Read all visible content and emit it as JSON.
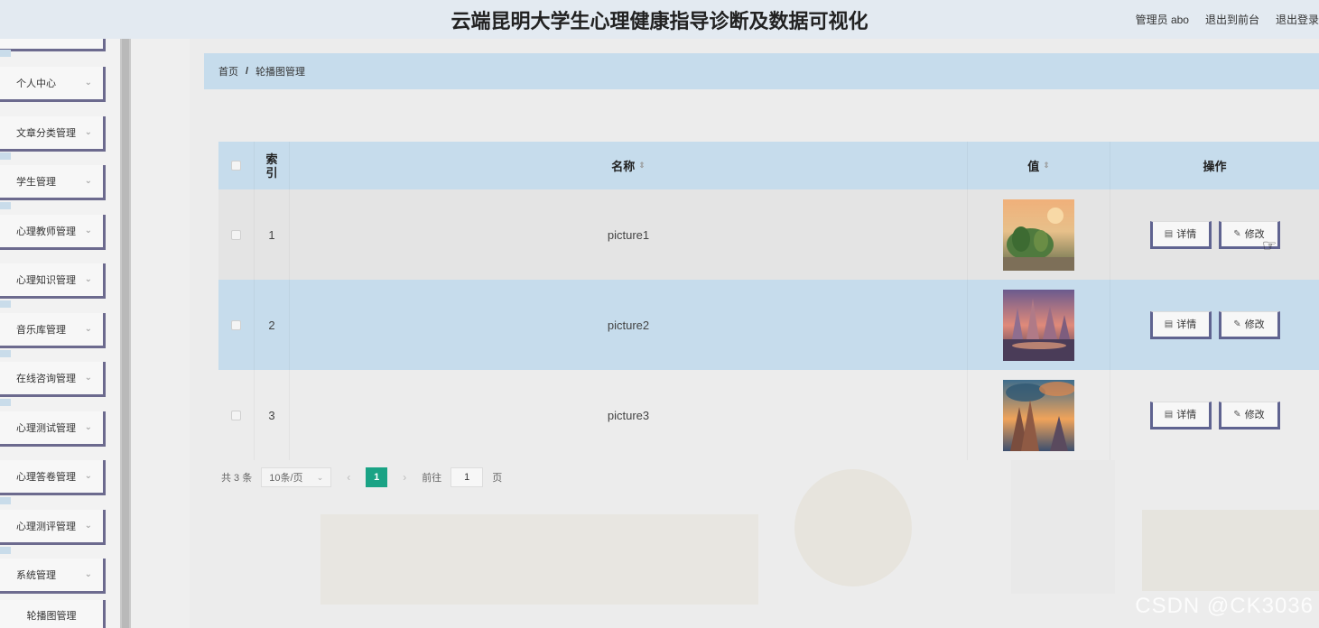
{
  "header": {
    "title": "云端昆明大学生心理健康指导诊断及数据可视化",
    "user_label": "管理员 abo",
    "to_front_label": "退出到前台",
    "logout_label": "退出登录"
  },
  "sidebar": {
    "items": [
      {
        "label": "个人中心"
      },
      {
        "label": "文章分类管理"
      },
      {
        "label": "学生管理"
      },
      {
        "label": "心理教师管理"
      },
      {
        "label": "心理知识管理"
      },
      {
        "label": "音乐库管理"
      },
      {
        "label": "在线咨询管理"
      },
      {
        "label": "心理测试管理"
      },
      {
        "label": "心理答卷管理"
      },
      {
        "label": "心理测评管理"
      },
      {
        "label": "系统管理"
      }
    ],
    "active_item": "轮播图管理"
  },
  "breadcrumb": {
    "home": "首页",
    "separator": "/",
    "current": "轮播图管理"
  },
  "table": {
    "headers": {
      "index": "索引",
      "index_line1": "索",
      "index_line2": "引",
      "name": "名称",
      "value": "值",
      "actions": "操作"
    },
    "rows": [
      {
        "index": "1",
        "name": "picture1",
        "thumb": "sunset-forest"
      },
      {
        "index": "2",
        "name": "picture2",
        "thumb": "fantasy-city"
      },
      {
        "index": "3",
        "name": "picture3",
        "thumb": "mountain-sky"
      }
    ],
    "detail_label": "详情",
    "edit_label": "修改"
  },
  "pagination": {
    "total_text": "共 3 条",
    "page_size": "10条/页",
    "current_page": "1",
    "goto_prefix": "前往",
    "goto_value": "1",
    "goto_suffix": "页"
  },
  "watermark": "CSDN @CK3036",
  "colors": {
    "header_bg": "#e3eaf1",
    "row_highlight": "#c6dcec",
    "button_border": "#5f6390",
    "pager_active": "#1aa385"
  }
}
